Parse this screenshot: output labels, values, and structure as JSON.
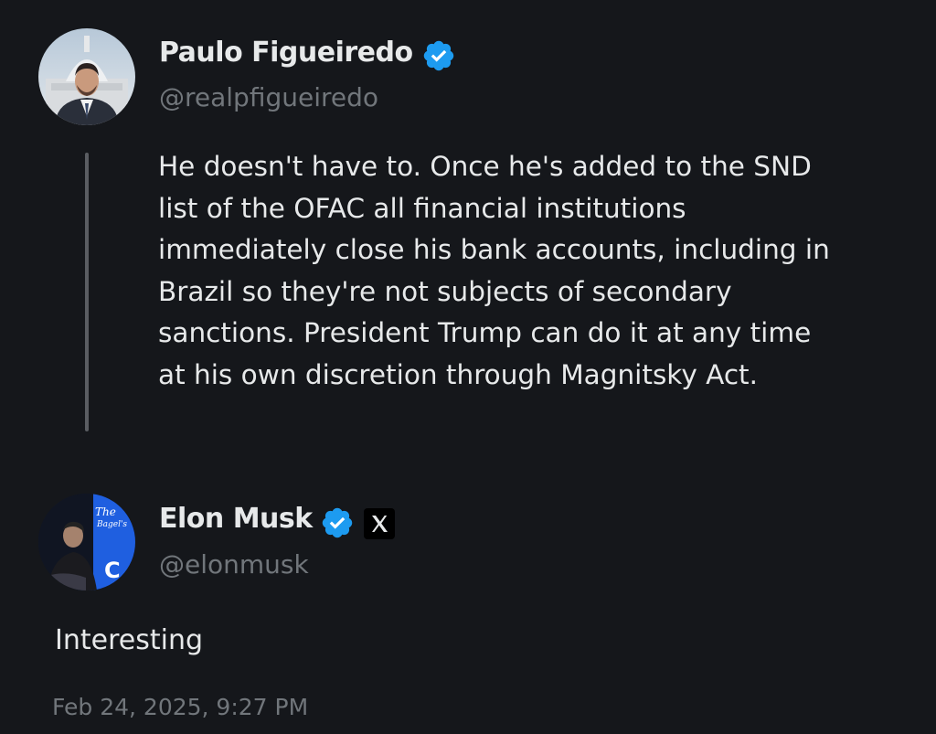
{
  "tweet": {
    "author_name": "Paulo Figueiredo",
    "author_handle": "@realpfigueiredo",
    "verified": true,
    "text_lines": [
      "He doesn't have to. Once he's added to the SND",
      "list of the OFAC all financial institutions",
      "immediately close his bank accounts, including in",
      "Brazil so they're not subjects of secondary",
      "sanctions. President Trump can do it at any time",
      "at his own discretion through Magnitsky Act."
    ]
  },
  "reply": {
    "author_name": "Elon Musk",
    "author_handle": "@elonmusk",
    "verified": true,
    "affiliate_icon": "x-logo-icon",
    "text": "Interesting",
    "timestamp": "Feb 24, 2025, 9:27 PM"
  },
  "colors": {
    "background": "#15171b",
    "text_primary": "#e7e9ea",
    "text_secondary": "#71767b",
    "verified_badge": "#1d9bf0",
    "thread_line": "#5a5d62"
  }
}
